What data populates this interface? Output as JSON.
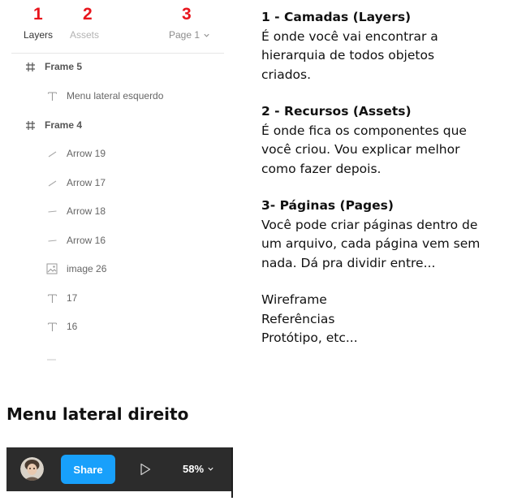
{
  "annotations": {
    "one": "1",
    "two": "2",
    "three": "3"
  },
  "panel": {
    "tabs": {
      "layers": "Layers",
      "assets": "Assets",
      "page": "Page 1"
    },
    "layers": [
      {
        "label": "Frame 5",
        "icon": "frame-icon"
      },
      {
        "label": "Menu lateral esquerdo",
        "icon": "text-icon"
      },
      {
        "label": "Frame 4",
        "icon": "frame-icon"
      },
      {
        "label": "Arrow 19",
        "icon": "arrow-line-icon"
      },
      {
        "label": "Arrow 17",
        "icon": "arrow-line-icon"
      },
      {
        "label": "Arrow 18",
        "icon": "line-icon"
      },
      {
        "label": "Arrow 16",
        "icon": "line-icon"
      },
      {
        "label": "image 26",
        "icon": "image-icon"
      },
      {
        "label": "17",
        "icon": "text-icon"
      },
      {
        "label": "16",
        "icon": "text-icon"
      }
    ]
  },
  "info": {
    "s1_title": "1 - Camadas (Layers)",
    "s1_l1": "É onde você vai encontrar a",
    "s1_l2": "hierarquia de todos objetos",
    "s1_l3": "criados.",
    "s2_title": "2 - Recursos (Assets)",
    "s2_l1": "É onde fica os componentes que",
    "s2_l2": "você criou. Vou explicar melhor",
    "s2_l3": "como fazer depois.",
    "s3_title": "3- Páginas (Pages)",
    "s3_l1": "Você pode criar páginas dentro de",
    "s3_l2": "um arquivo, cada página vem sem",
    "s3_l3": "nada. Dá pra dividir entre...",
    "list1": "Wireframe",
    "list2": "Referências",
    "list3": "Protótipo, etc..."
  },
  "section_title": "Menu lateral direito",
  "toolbar": {
    "share_label": "Share",
    "zoom_label": "58%",
    "accent": "#18a0fb",
    "background": "#2c2c2c"
  }
}
